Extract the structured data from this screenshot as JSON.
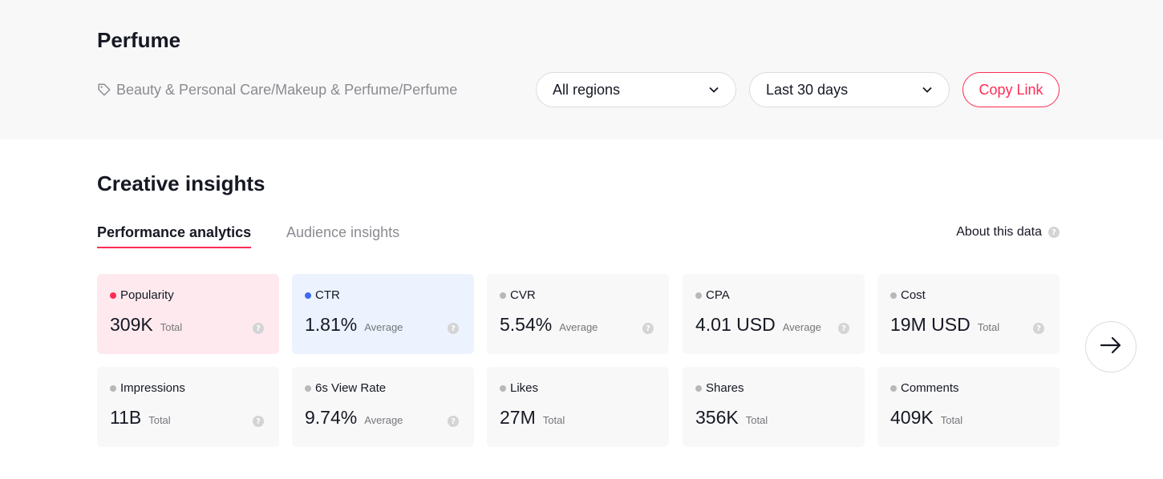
{
  "header": {
    "title": "Perfume",
    "category_path": "Beauty & Personal Care/Makeup & Perfume/Perfume",
    "region_select": {
      "selected": "All regions"
    },
    "period_select": {
      "selected": "Last 30 days"
    },
    "copy_link_label": "Copy Link"
  },
  "section": {
    "title": "Creative insights",
    "tabs": [
      {
        "label": "Performance analytics",
        "active": true
      },
      {
        "label": "Audience insights",
        "active": false
      }
    ],
    "about_label": "About this data"
  },
  "metrics": [
    {
      "label": "Popularity",
      "value": "309K",
      "unit": "Total",
      "dot_color": "#fe2c55",
      "card_color": "#feeaee",
      "has_help": true
    },
    {
      "label": "CTR",
      "value": "1.81%",
      "unit": "Average",
      "dot_color": "#3c6bf0",
      "card_color": "#ecf3fe",
      "has_help": true
    },
    {
      "label": "CVR",
      "value": "5.54%",
      "unit": "Average",
      "dot_color": "#b8b8ba",
      "card_color": "#f8f8f8",
      "has_help": true
    },
    {
      "label": "CPA",
      "value": "4.01 USD",
      "unit": "Average",
      "dot_color": "#b8b8ba",
      "card_color": "#f8f8f8",
      "has_help": true
    },
    {
      "label": "Cost",
      "value": "19M USD",
      "unit": "Total",
      "dot_color": "#b8b8ba",
      "card_color": "#f8f8f8",
      "has_help": true
    },
    {
      "label": "Impressions",
      "value": "11B",
      "unit": "Total",
      "dot_color": "#b8b8ba",
      "card_color": "#f8f8f8",
      "has_help": true
    },
    {
      "label": "6s View Rate",
      "value": "9.74%",
      "unit": "Average",
      "dot_color": "#b8b8ba",
      "card_color": "#f8f8f8",
      "has_help": true
    },
    {
      "label": "Likes",
      "value": "27M",
      "unit": "Total",
      "dot_color": "#b8b8ba",
      "card_color": "#f8f8f8",
      "has_help": false
    },
    {
      "label": "Shares",
      "value": "356K",
      "unit": "Total",
      "dot_color": "#b8b8ba",
      "card_color": "#f8f8f8",
      "has_help": false
    },
    {
      "label": "Comments",
      "value": "409K",
      "unit": "Total",
      "dot_color": "#b8b8ba",
      "card_color": "#f8f8f8",
      "has_help": false
    }
  ],
  "help_glyph": "?",
  "icons": {
    "tag": "tag-icon",
    "chevron": "chevron-down-icon",
    "next": "arrow-right-icon",
    "help": "question-circle-icon"
  },
  "colors": {
    "accent": "#fe2c55",
    "blue": "#3c6bf0",
    "muted": "#8a8b91"
  }
}
